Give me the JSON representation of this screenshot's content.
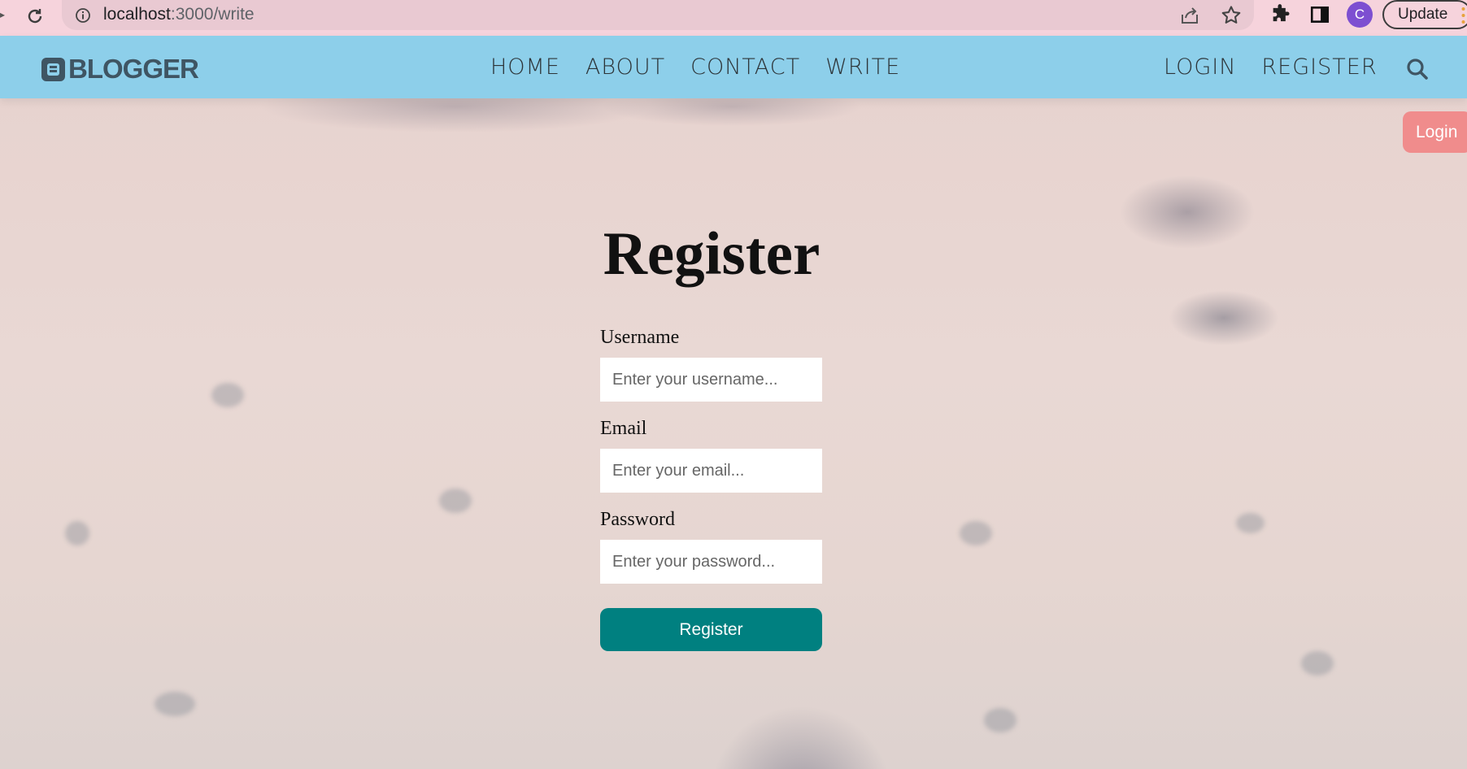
{
  "browser": {
    "url_host": "localhost",
    "url_path": ":3000/write",
    "avatar_letter": "C",
    "update_label": "Update"
  },
  "site": {
    "logo_text": "BLOGGER",
    "nav": [
      {
        "label": "HOME"
      },
      {
        "label": "ABOUT"
      },
      {
        "label": "CONTACT"
      },
      {
        "label": "WRITE"
      }
    ],
    "auth": [
      {
        "label": "LOGIN"
      },
      {
        "label": "REGISTER"
      }
    ],
    "floating_login_label": "Login"
  },
  "register": {
    "title": "Register",
    "username_label": "Username",
    "username_placeholder": "Enter your username...",
    "email_label": "Email",
    "email_placeholder": "Enter your email...",
    "password_label": "Password",
    "password_placeholder": "Enter your password...",
    "submit_label": "Register"
  },
  "colors": {
    "topbar": "#8dcfea",
    "submit": "#008080",
    "floating_login": "#f08c8c",
    "chrome": "#f6d3dc"
  }
}
